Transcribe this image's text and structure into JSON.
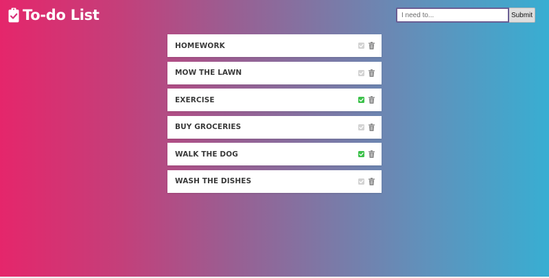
{
  "header": {
    "title": "To-do List",
    "icon": "clipboard-check-icon"
  },
  "form": {
    "placeholder": "I need to...",
    "value": "",
    "submit_label": "Submit"
  },
  "colors": {
    "checked": "#3cc14a",
    "unchecked": "#d3d3d3",
    "trash": "#8a8a8a",
    "gradient_start": "#e5266b",
    "gradient_end": "#38aed2"
  },
  "todos": [
    {
      "text": "HOMEWORK",
      "done": false
    },
    {
      "text": "MOW THE LAWN",
      "done": false
    },
    {
      "text": "EXERCISE",
      "done": true
    },
    {
      "text": "BUY GROCERIES",
      "done": false
    },
    {
      "text": "WALK THE DOG",
      "done": true
    },
    {
      "text": "WASH THE DISHES",
      "done": false
    }
  ]
}
